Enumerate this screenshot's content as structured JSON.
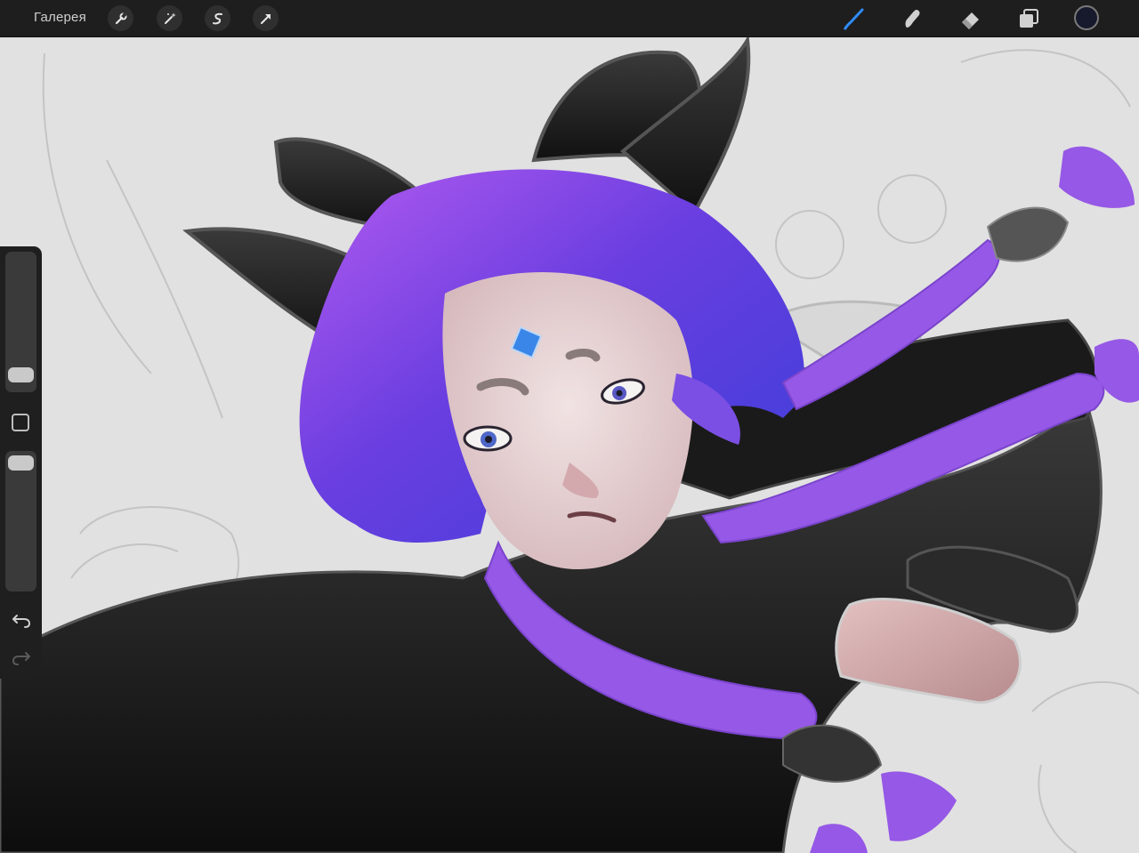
{
  "topbar": {
    "gallery_label": "Галерея",
    "left_tools": [
      "wrench-icon",
      "magic-wand-icon",
      "selection-icon",
      "transform-arrow-icon"
    ],
    "right_tools": [
      "brush-icon",
      "smudge-icon",
      "eraser-icon",
      "layers-icon"
    ],
    "active_tool": "brush-icon",
    "active_color": "#171a2c",
    "accent_color": "#2f8cff"
  },
  "sidebar": {
    "brush_size_level": 0.2,
    "opacity_level": 0.95
  }
}
